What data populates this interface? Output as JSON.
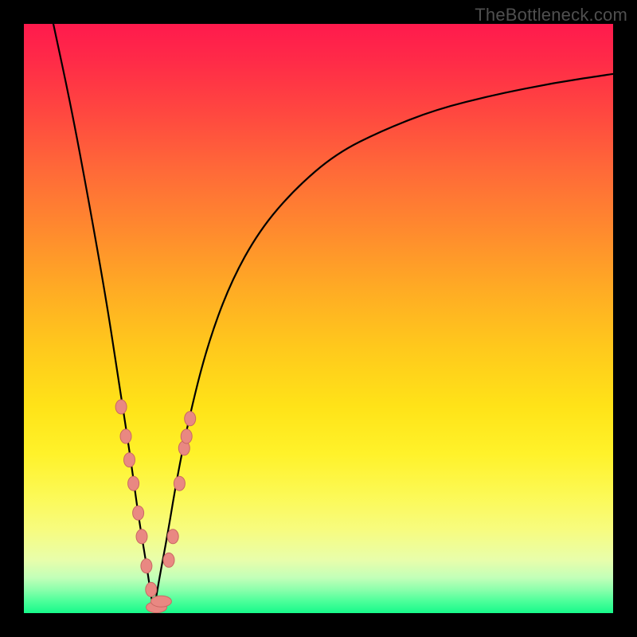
{
  "watermark": "TheBottleneck.com",
  "colors": {
    "curve": "#000000",
    "dot_fill": "#e98882",
    "dot_stroke": "#c96863"
  },
  "chart_data": {
    "type": "line",
    "title": "",
    "xlabel": "",
    "ylabel": "",
    "x_range": [
      0,
      100
    ],
    "y_range": [
      0,
      100
    ],
    "notch_x": 22,
    "series": [
      {
        "name": "bottleneck-curve",
        "comment": "y is the bottleneck percentage; minimum (0) at notch_x, rising sharply on both sides. Values are visual estimates.",
        "x": [
          5,
          8,
          11,
          14,
          16,
          18,
          19.5,
          21,
          22,
          23,
          24.5,
          26,
          28,
          31,
          35,
          40,
          46,
          53,
          61,
          70,
          80,
          90,
          100
        ],
        "y": [
          100,
          86,
          70,
          53,
          40,
          27,
          16,
          7,
          0,
          6,
          14,
          23,
          33,
          45,
          56,
          65,
          72,
          78,
          82,
          85.5,
          88,
          90,
          91.5
        ]
      }
    ],
    "points": {
      "name": "highlighted-samples",
      "comment": "Salmon dots near the notch; visual estimates of device samples.",
      "x": [
        16.5,
        17.3,
        17.9,
        18.6,
        19.4,
        20.0,
        20.8,
        21.6,
        22.5,
        23.3,
        24.6,
        25.3,
        26.4,
        27.2,
        27.6,
        28.2
      ],
      "y": [
        35,
        30,
        26,
        22,
        17,
        13,
        8,
        4,
        1,
        2,
        9,
        13,
        22,
        28,
        30,
        33
      ]
    }
  }
}
